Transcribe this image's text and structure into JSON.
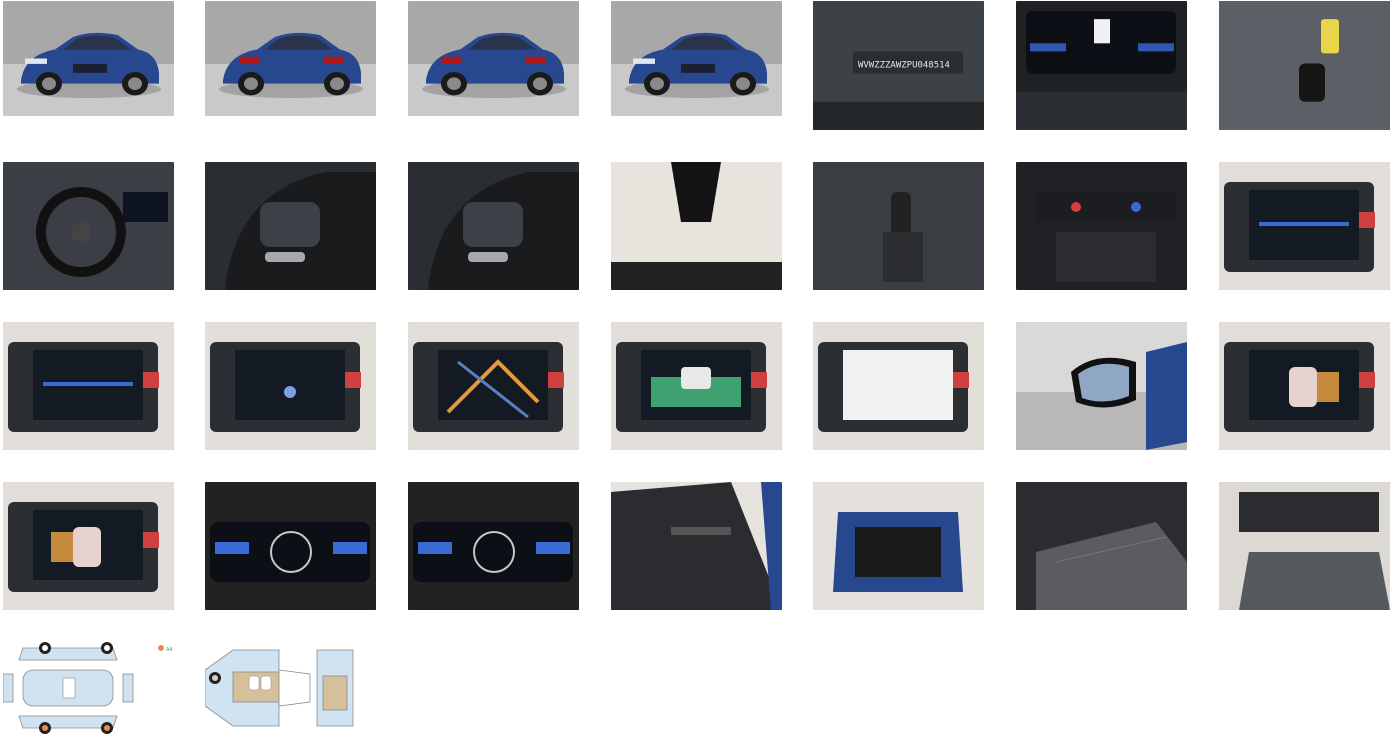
{
  "gallery": {
    "photos": [
      {
        "subject": "exterior-front-left",
        "icon": "car-front-icon"
      },
      {
        "subject": "exterior-rear-left",
        "icon": "car-rear-icon"
      },
      {
        "subject": "exterior-rear",
        "icon": "car-rear-icon"
      },
      {
        "subject": "exterior-front-right",
        "icon": "car-front-icon"
      },
      {
        "subject": "vin-plate",
        "icon": "vin-icon",
        "text": "WVWZZZAWZPU048514"
      },
      {
        "subject": "instrument-cluster",
        "icon": "gauge-icon"
      },
      {
        "subject": "keys",
        "icon": "key-icon"
      },
      {
        "subject": "dashboard-steering-wheel",
        "icon": "steering-wheel-icon"
      },
      {
        "subject": "steering-wheel-left-controls",
        "icon": "steering-wheel-icon"
      },
      {
        "subject": "steering-wheel-right-controls",
        "icon": "steering-wheel-icon"
      },
      {
        "subject": "windshield-sensor",
        "icon": "camera-icon"
      },
      {
        "subject": "gear-shifter",
        "icon": "gear-shift-icon"
      },
      {
        "subject": "climate-controls",
        "icon": "climate-icon"
      },
      {
        "subject": "infotainment-radio",
        "icon": "radio-icon"
      },
      {
        "subject": "infotainment-screen",
        "icon": "screen-icon"
      },
      {
        "subject": "infotainment-welcome",
        "icon": "screen-icon"
      },
      {
        "subject": "infotainment-navigation",
        "icon": "map-icon"
      },
      {
        "subject": "infotainment-park-assist",
        "icon": "parking-icon"
      },
      {
        "subject": "infotainment-service",
        "icon": "service-icon"
      },
      {
        "subject": "side-mirror",
        "icon": "mirror-icon"
      },
      {
        "subject": "parking-sensors-rear",
        "icon": "parking-icon"
      },
      {
        "subject": "parking-sensors-front",
        "icon": "parking-icon"
      },
      {
        "subject": "digital-cockpit-1",
        "icon": "gauge-icon"
      },
      {
        "subject": "digital-cockpit-2",
        "icon": "gauge-icon"
      },
      {
        "subject": "door-interior",
        "icon": "door-icon"
      },
      {
        "subject": "trunk",
        "icon": "trunk-icon"
      },
      {
        "subject": "rear-seats",
        "icon": "seat-icon"
      },
      {
        "subject": "front-seats",
        "icon": "seat-icon"
      }
    ],
    "diagrams": [
      {
        "subject": "exterior-damage-diagram",
        "icon": "car-diagram-icon",
        "marker_label": "A4"
      },
      {
        "subject": "interior-damage-diagram",
        "icon": "car-interior-diagram-icon"
      }
    ]
  },
  "colors": {
    "car_blue": "#27488f",
    "studio_gray": "#9a9a9a",
    "dark_interior": "#1f2124",
    "screen_blue": "#3a6ad6",
    "marker_orange": "#f08a50",
    "marker_green": "#3caa5a",
    "diagram_blue": "#cfe3f3",
    "diagram_tan": "#d6c09b"
  }
}
